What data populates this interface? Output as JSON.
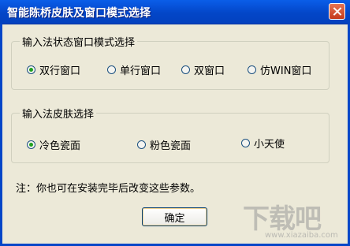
{
  "window": {
    "title": "智能陈桥皮肤及窗口模式选择"
  },
  "groups": [
    {
      "title": "输入法状态窗口模式选择",
      "options": [
        {
          "label": "双行窗口",
          "checked": true
        },
        {
          "label": "单行窗口",
          "checked": false
        },
        {
          "label": "双窗口",
          "checked": false
        },
        {
          "label": "仿WIN窗口",
          "checked": false
        }
      ]
    },
    {
      "title": "输入法皮肤选择",
      "options": [
        {
          "label": "冷色瓷面",
          "checked": true
        },
        {
          "label": "粉色瓷面",
          "checked": false
        },
        {
          "label": "小天使",
          "checked": false
        }
      ]
    }
  ],
  "note": "注：你也可在安装完毕后改变这些参数。",
  "buttons": {
    "ok": "确定"
  },
  "watermark": {
    "logo": "下载吧",
    "url": "www.xiazaiba.com"
  },
  "colors": {
    "titlebar": "#0346c8",
    "dialog_bg": "#ece9d8",
    "radio_selected": "#21a121"
  }
}
